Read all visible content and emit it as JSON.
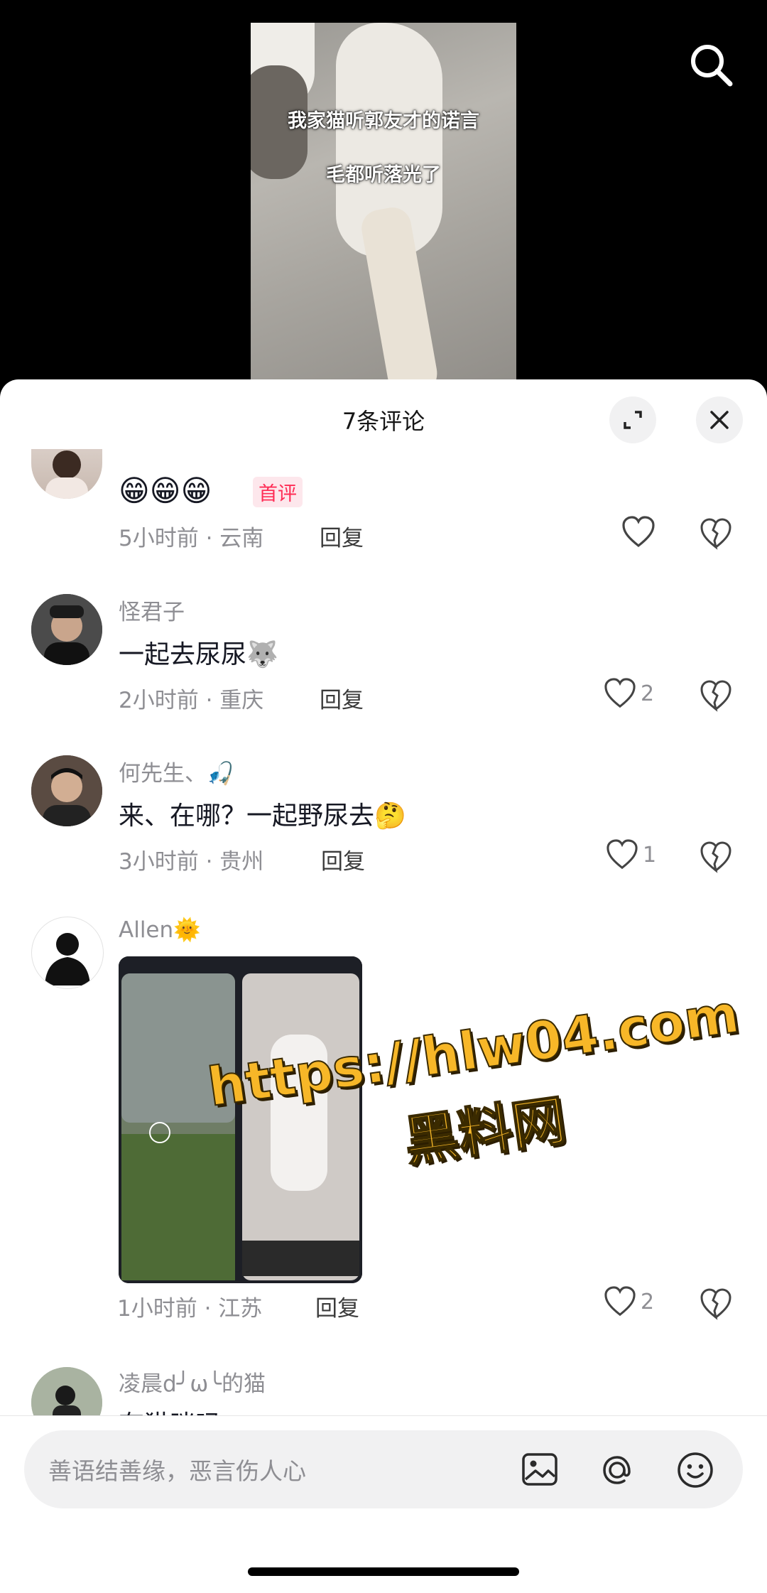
{
  "video": {
    "caption_line1": "我家猫听郭友才的诺言",
    "caption_line2": "毛都听落光了"
  },
  "sheet": {
    "title": "7条评论"
  },
  "comments": [
    {
      "emoji_text": "😁😁😁",
      "badge": "首评",
      "meta": "5小时前 · 云南",
      "reply": "回复"
    },
    {
      "name": "怪君子",
      "text": "一起去尿尿🐺",
      "meta": "2小时前 · 重庆",
      "reply": "回复",
      "likes": "2"
    },
    {
      "name": "何先生、🎣",
      "text": "来、在哪？一起野尿去🤔",
      "meta": "3小时前 · 贵州",
      "reply": "回复",
      "likes": "1"
    },
    {
      "name": "Allen🌞",
      "meta": "1小时前 · 江苏",
      "reply": "回复",
      "likes": "2",
      "image_watermark_line1": "https://hlw04.com",
      "image_watermark_line2": "黑料网"
    },
    {
      "name": "凌晨d╯ω╰的猫",
      "text": "有猫咪吗"
    }
  ],
  "input": {
    "placeholder": "善语结善缘，恶言伤人心"
  },
  "icons": [
    "search-icon",
    "expand-icon",
    "close-icon",
    "heart-icon",
    "broken-heart-icon",
    "image-icon",
    "at-icon",
    "emoji-icon"
  ]
}
